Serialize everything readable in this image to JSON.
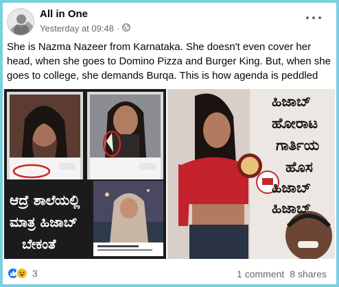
{
  "post": {
    "author": "All in One",
    "timestamp": "Yesterday at 09:48",
    "separator": "·",
    "audience_icon": "globe-icon",
    "text": "She is Nazma Nazeer from Karnataka. She doesn't even cover her head, when she goes to Domino Pizza and Burger King. But, when she goes to college, she demands Burqa. This is how agenda is peddled"
  },
  "media": {
    "left": {
      "line1": "ಆದ್ರೆ ಶಾಲೆಯಲ್ಲಿ",
      "line2": "ಮಾತ್ರ ಹಿಜಾಬ್",
      "line3": "ಬೇಕಂತೆ"
    },
    "right": {
      "line1": "ಹಿಜಾಬ್",
      "line2": "ಹೋರಾಟ",
      "line3": "ಗಾರ್ತಿಯ",
      "line4": "ಹೊಸ",
      "line5": "ಹಿಜಾಬ್",
      "line6": "ಹಿಜಾಬ್"
    }
  },
  "footer": {
    "reaction_icons": [
      "like-icon",
      "haha-icon"
    ],
    "reaction_count": "3",
    "comments": "1 comment",
    "shares": "8 shares"
  },
  "colors": {
    "background": "#7ccfe0",
    "like": "#1877f2",
    "haha": "#f7b928",
    "text_secondary": "#65676b"
  }
}
